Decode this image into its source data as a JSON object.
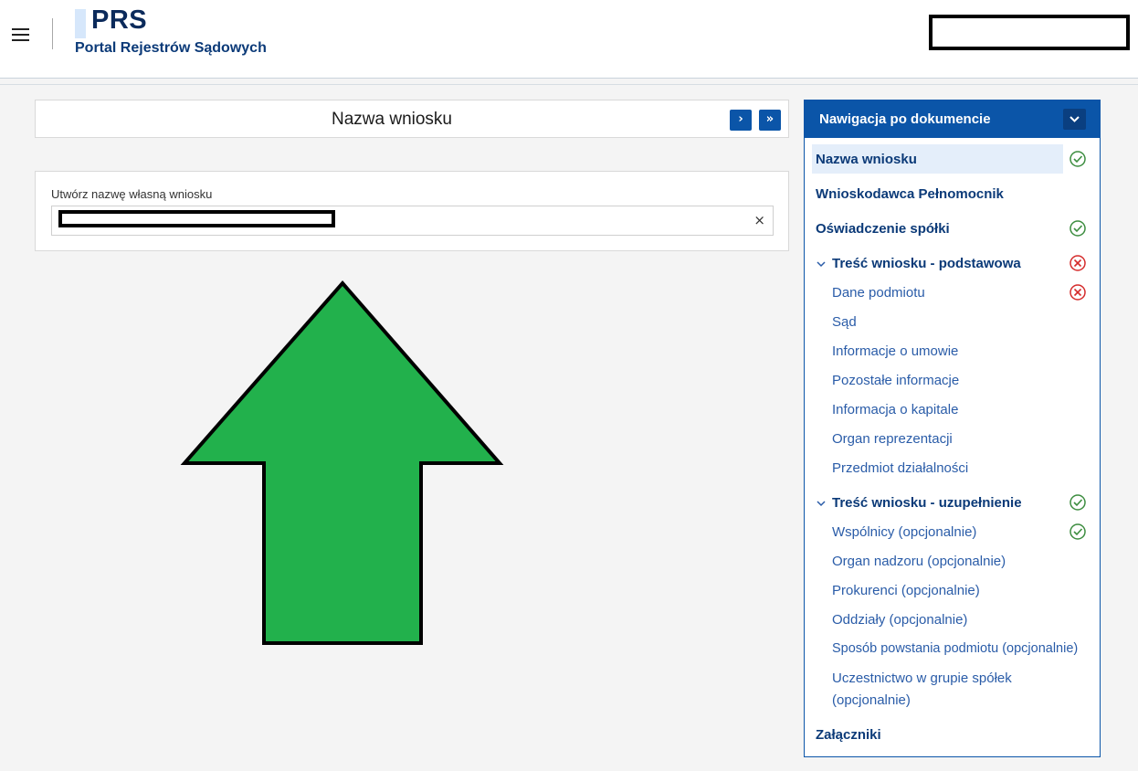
{
  "header": {
    "logo": "PRS",
    "subtitle": "Portal Rejestrów Sądowych"
  },
  "titlebar": {
    "title": "Nazwa wniosku",
    "next_label": "›",
    "last_label": "»"
  },
  "form": {
    "label": "Utwórz nazwę własną wniosku",
    "value": "",
    "clear_label": "×"
  },
  "colors": {
    "primary": "#0b55a8",
    "ok": "#3c8d3f",
    "error": "#d52b2b",
    "arrow": "#22b14c"
  },
  "sidenav": {
    "title": "Nawigacja po dokumencie",
    "items": [
      {
        "label": "Nazwa wniosku",
        "status": "ok"
      },
      {
        "label": "Wnioskodawca Pełnomocnik",
        "status": ""
      },
      {
        "label": "Oświadczenie spółki",
        "status": "ok"
      },
      {
        "label": "Treść wniosku - podstawowa",
        "status": "error"
      },
      {
        "label": "Dane podmiotu",
        "status": "error"
      },
      {
        "label": "Sąd",
        "status": ""
      },
      {
        "label": "Informacje o umowie",
        "status": ""
      },
      {
        "label": "Pozostałe informacje",
        "status": ""
      },
      {
        "label": "Informacja o kapitale",
        "status": ""
      },
      {
        "label": "Organ reprezentacji",
        "status": ""
      },
      {
        "label": "Przedmiot działalności",
        "status": ""
      },
      {
        "label": "Treść wniosku - uzupełnienie",
        "status": "ok"
      },
      {
        "label": "Wspólnicy (opcjonalnie)",
        "status": "ok"
      },
      {
        "label": "Organ nadzoru (opcjonalnie)",
        "status": ""
      },
      {
        "label": "Prokurenci (opcjonalnie)",
        "status": ""
      },
      {
        "label": "Oddziały (opcjonalnie)",
        "status": ""
      },
      {
        "label": "Sposób powstania podmiotu (opcjonalnie)",
        "status": ""
      },
      {
        "label": "Uczestnictwo w grupie spółek",
        "status": ""
      },
      {
        "label": "(opcjonalnie)",
        "status": ""
      },
      {
        "label": "Załączniki",
        "status": ""
      }
    ]
  }
}
